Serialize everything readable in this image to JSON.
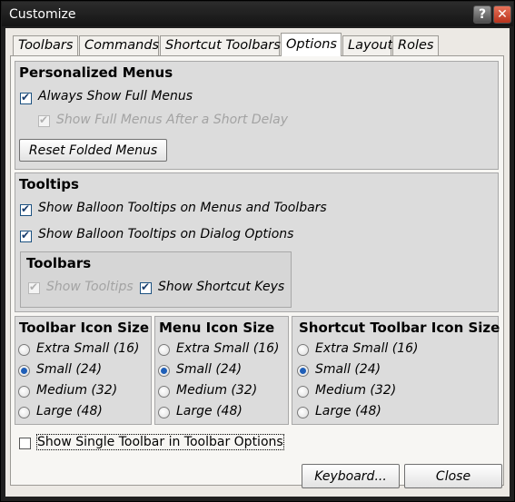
{
  "window": {
    "title": "Customize",
    "help_label": "?",
    "close_label": "✕"
  },
  "tabs": [
    "Toolbars",
    "Commands",
    "Shortcut Toolbars",
    "Options",
    "Layout",
    "Roles"
  ],
  "personalized_menus": {
    "title": "Personalized Menus",
    "always_show_full_menus": {
      "label": "Always Show Full Menus",
      "checked": true
    },
    "show_after_delay": {
      "label": "Show Full Menus After a Short Delay",
      "checked": true,
      "disabled": true
    },
    "reset_button": "Reset Folded Menus"
  },
  "tooltips": {
    "title": "Tooltips",
    "balloon_menus": {
      "label": "Show Balloon Tooltips on Menus and Toolbars",
      "checked": true
    },
    "balloon_dialog": {
      "label": "Show Balloon Tooltips on Dialog Options",
      "checked": true
    },
    "toolbars": {
      "title": "Toolbars",
      "show_tooltips": {
        "label": "Show Tooltips",
        "checked": true,
        "disabled": true
      },
      "show_shortcut_keys": {
        "label": "Show Shortcut Keys",
        "checked": true
      }
    }
  },
  "icon_sizes": [
    {
      "title": "Toolbar Icon Size",
      "options": [
        "Extra Small (16)",
        "Small (24)",
        "Medium (32)",
        "Large (48)"
      ],
      "selected": 1
    },
    {
      "title": "Menu Icon Size",
      "options": [
        "Extra Small (16)",
        "Small (24)",
        "Medium (32)",
        "Large (48)"
      ],
      "selected": 1
    },
    {
      "title": "Shortcut Toolbar Icon Size",
      "options": [
        "Extra Small (16)",
        "Small (24)",
        "Medium (32)",
        "Large (48)"
      ],
      "selected": 1
    }
  ],
  "single_toolbar": {
    "label": "Show Single Toolbar in Toolbar Options",
    "checked": false
  },
  "buttons": {
    "keyboard": "Keyboard...",
    "close": "Close"
  }
}
